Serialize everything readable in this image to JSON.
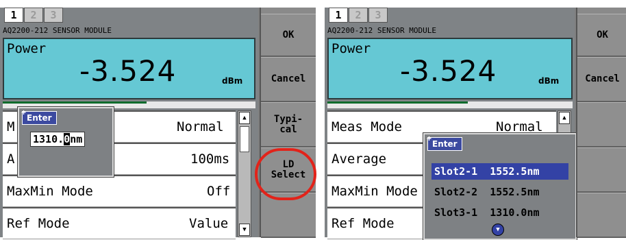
{
  "panels": [
    {
      "tabs": [
        "1",
        "2",
        "3"
      ],
      "active_tab": "1",
      "module_title": "AQ2200-212 SENSOR MODULE",
      "power_label": "Power",
      "power_value": "-3.524",
      "power_unit": "dBm",
      "settings": [
        {
          "label": "M",
          "value": "Normal"
        },
        {
          "label": "A",
          "value": "100ms"
        },
        {
          "label": "MaxMin Mode",
          "value": "Off"
        },
        {
          "label": "Ref Mode",
          "value": "Value"
        }
      ],
      "softkeys": [
        "OK",
        "Cancel",
        "Typi-\ncal",
        "LD\nSelect",
        ""
      ],
      "enter_popup": {
        "tag": "Enter",
        "value_before": "1310.",
        "cursor_char": "0",
        "value_after": "nm"
      }
    },
    {
      "tabs": [
        "1",
        "2",
        "3"
      ],
      "active_tab": "1",
      "module_title": "AQ2200-212 SENSOR MODULE",
      "power_label": "Power",
      "power_value": "-3.524",
      "power_unit": "dBm",
      "settings": [
        {
          "label": "Meas Mode",
          "value": "Normal"
        },
        {
          "label": "Average",
          "value": ""
        },
        {
          "label": "MaxMin Mode",
          "value": ""
        },
        {
          "label": "Ref Mode",
          "value": ""
        }
      ],
      "softkeys": [
        "OK",
        "Cancel",
        "",
        "",
        ""
      ],
      "select_popup": {
        "tag": "Enter",
        "items": [
          "Slot2-1  1552.5nm",
          "Slot2-2  1552.5nm",
          "Slot3-1  1310.0nm"
        ],
        "selected_index": 0
      }
    }
  ],
  "highlight_color": "#e2231a",
  "accent_color": "#3342a5",
  "display_color": "#65c8d4"
}
